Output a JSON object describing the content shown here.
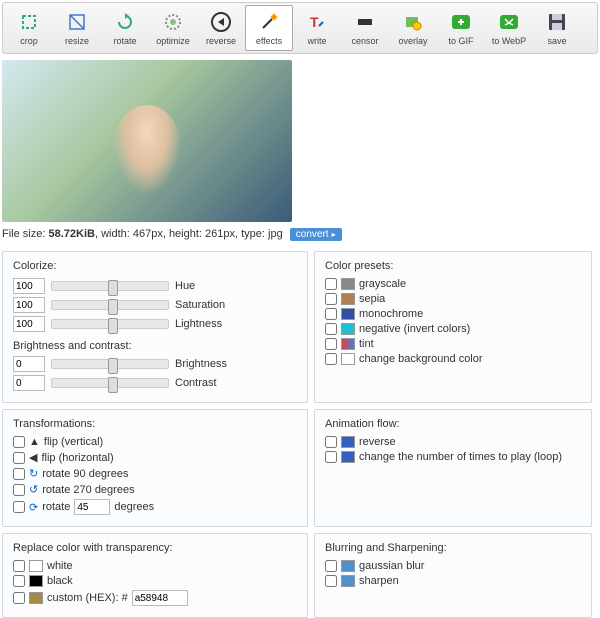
{
  "toolbar": {
    "crop": "crop",
    "resize": "resize",
    "rotate": "rotate",
    "optimize": "optimize",
    "reverse": "reverse",
    "effects": "effects",
    "write": "write",
    "censor": "censor",
    "overlay": "overlay",
    "to_gif": "to GIF",
    "to_webp": "to WebP",
    "save": "save"
  },
  "fileinfo": {
    "prefix": "File size: ",
    "size": "58.72KiB",
    "rest": ", width: 467px, height: 261px, type: jpg",
    "convert": "convert"
  },
  "colorize": {
    "title": "Colorize:",
    "hue_val": "100",
    "hue_label": "Hue",
    "sat_val": "100",
    "sat_label": "Saturation",
    "light_val": "100",
    "light_label": "Lightness"
  },
  "bc": {
    "title": "Brightness and contrast:",
    "b_val": "0",
    "b_label": "Brightness",
    "c_val": "0",
    "c_label": "Contrast"
  },
  "presets": {
    "title": "Color presets:",
    "grayscale": "grayscale",
    "sepia": "sepia",
    "monochrome": "monochrome",
    "negative": "negative (invert colors)",
    "tint": "tint",
    "change_bg": "change background color"
  },
  "transforms": {
    "title": "Transformations:",
    "flip_v": "flip (vertical)",
    "flip_h": "flip (horizontal)",
    "rot90": "rotate 90 degrees",
    "rot270": "rotate 270 degrees",
    "rot_custom_pre": "rotate",
    "rot_custom_val": "45",
    "rot_custom_post": "degrees"
  },
  "anim": {
    "title": "Animation flow:",
    "reverse": "reverse",
    "loop": "change the number of times to play (loop)"
  },
  "replace": {
    "title": "Replace color with transparency:",
    "white": "white",
    "black": "black",
    "custom_pre": "custom (HEX): #",
    "custom_val": "a58948"
  },
  "blur": {
    "title": "Blurring and Sharpening:",
    "gaussian": "gaussian blur",
    "sharpen": "sharpen"
  },
  "colors": {
    "grayscale": "#888888",
    "sepia": "#b08050",
    "mono": "#3050a0",
    "neg": "#20c0d0",
    "tint1": "#e04040",
    "tint2": "#4080e0",
    "bg": "#ffffff",
    "reverse": "#3060c0",
    "loop": "#3060c0",
    "white": "#ffffff",
    "black": "#000000",
    "custom": "#a58948",
    "blur": "#5090d0",
    "sharpen": "#5090d0"
  }
}
